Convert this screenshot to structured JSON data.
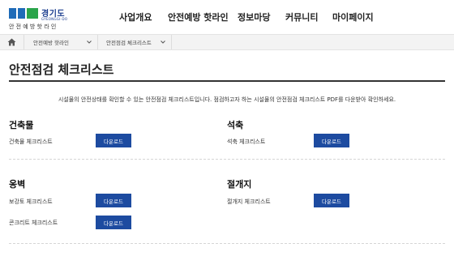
{
  "header": {
    "logo_title": "경기도",
    "logo_sub_en": "GYEONGGI-DO",
    "logo_tag": "안전예방핫라인",
    "nav": [
      "사업개요",
      "안전예방 핫라인",
      "정보마당",
      "커뮤니티",
      "마이페이지"
    ]
  },
  "breadcrumb": {
    "level1": "안전예방 핫라인",
    "level2": "안전점검 체크리스트"
  },
  "page": {
    "title": "안전점검 체크리스트",
    "intro": "시설물의 안전상태를 확인할 수 있는 안전점검 체크리스트입니다. 점검하고자 하는 시설물의 안전점검 체크리스트 PDF를 다운받아 확인하세요."
  },
  "sections": {
    "building": {
      "title": "건축물",
      "items": [
        {
          "label": "건축물 체크리스트",
          "button": "다운로드"
        }
      ]
    },
    "masonry": {
      "title": "석축",
      "items": [
        {
          "label": "석축 체크리스트",
          "button": "다운로드"
        }
      ]
    },
    "retaining_wall": {
      "title": "옹벽",
      "items": [
        {
          "label": "보강토 체크리스트",
          "button": "다운로드"
        },
        {
          "label": "콘크리트 체크리스트",
          "button": "다운로드"
        }
      ]
    },
    "slope": {
      "title": "절개지",
      "items": [
        {
          "label": "절개지 체크리스트",
          "button": "다운로드"
        }
      ]
    }
  },
  "colors": {
    "button": "#1d4ba0",
    "logo_blue": "#1e6bb8",
    "logo_green": "#2aa44a"
  },
  "icons": {
    "home": "home-icon",
    "dropdown": "chevron-down-icon"
  }
}
